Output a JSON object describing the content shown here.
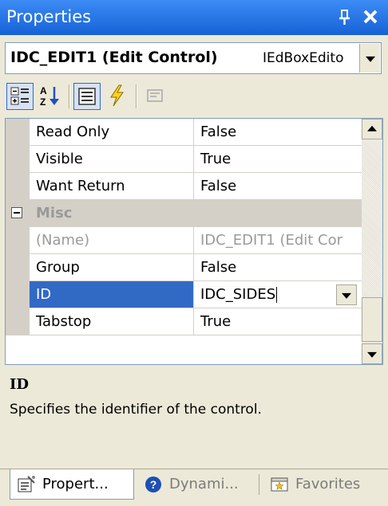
{
  "window": {
    "title": "Properties",
    "pin_icon": "pin-icon",
    "close_icon": "close-icon"
  },
  "object_selector": {
    "name": "IDC_EDIT1 (Edit Control)",
    "type": "IEdBoxEdito"
  },
  "toolbar": {
    "buttons": [
      {
        "name": "categorized-icon",
        "pressed": true
      },
      {
        "name": "alphabetical-icon",
        "pressed": false
      },
      {
        "name": "properties-icon",
        "pressed": true
      },
      {
        "name": "events-icon",
        "pressed": false
      },
      {
        "name": "property-pages-icon",
        "pressed": false,
        "disabled": true
      }
    ]
  },
  "grid": {
    "rows": [
      {
        "name": "Read Only",
        "value": "False"
      },
      {
        "name": "Visible",
        "value": "True"
      },
      {
        "name": "Want Return",
        "value": "False"
      }
    ],
    "category": {
      "label": "Misc",
      "expanded": true
    },
    "misc_rows": [
      {
        "name": "(Name)",
        "value": "IDC_EDIT1 (Edit Cor",
        "disabled": true
      },
      {
        "name": "Group",
        "value": "False"
      },
      {
        "name": "ID",
        "value": "IDC_SIDES",
        "selected": true,
        "editing": true
      },
      {
        "name": "Tabstop",
        "value": "True"
      }
    ]
  },
  "description": {
    "title": "ID",
    "text": "Specifies the identifier of the control."
  },
  "tabs": [
    {
      "label": "Propert...",
      "icon": "property-sheet-icon",
      "active": true
    },
    {
      "label": "Dynami...",
      "icon": "help-icon",
      "active": false
    },
    {
      "label": "Favorites",
      "icon": "favorites-icon",
      "active": false
    }
  ],
  "colors": {
    "titlebar": "#2b71de",
    "selection": "#316ac5",
    "category_bg": "#d4d0c8"
  }
}
